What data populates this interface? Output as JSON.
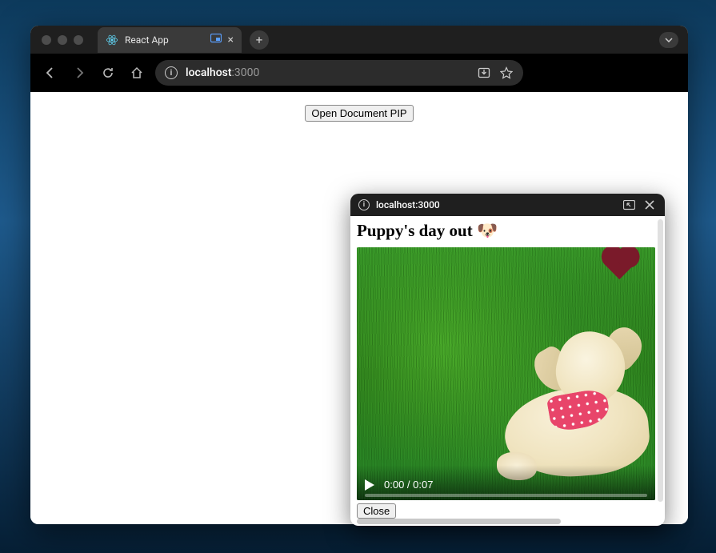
{
  "browser": {
    "tab": {
      "title": "React App"
    },
    "address": {
      "host": "localhost",
      "port": ":3000"
    }
  },
  "page": {
    "open_pip_button": "Open Document PIP"
  },
  "pip": {
    "url": "localhost:3000",
    "title": "Puppy's day out 🐶",
    "video": {
      "current_time": "0:00",
      "duration": "0:07",
      "time_display": "0:00 / 0:07"
    },
    "close_button": "Close"
  }
}
